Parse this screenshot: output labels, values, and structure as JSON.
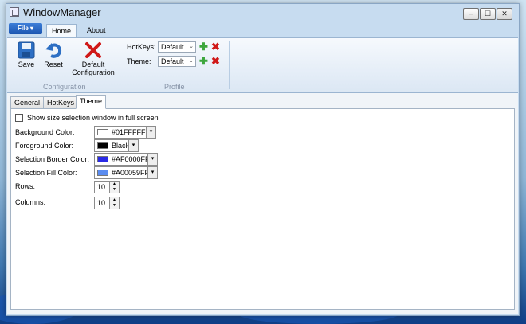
{
  "window": {
    "title": "WindowManager"
  },
  "window_controls": {
    "minimize": "–",
    "maximize": "☐",
    "close": "✕"
  },
  "ribbon_tabs": {
    "file": "File ▾",
    "home": "Home",
    "about": "About"
  },
  "ribbon": {
    "configuration": {
      "group_label": "Configuration",
      "save": "Save",
      "reset": "Reset",
      "default_line1": "Default",
      "default_line2": "Configuration"
    },
    "profile": {
      "group_label": "Profile",
      "hotkeys_label": "HotKeys:",
      "hotkeys_value": "Default",
      "theme_label": "Theme:",
      "theme_value": "Default"
    }
  },
  "content_tabs": {
    "general": "General",
    "hotkeys": "HotKeys",
    "theme": "Theme"
  },
  "theme": {
    "fullscreen_checkbox_label": "Show size selection window in full screen",
    "background_label": "Background Color:",
    "background_value": "#01FFFFFF",
    "background_swatch": "#FFFFFF",
    "foreground_label": "Foreground Color:",
    "foreground_value": "Black",
    "foreground_swatch": "#000000",
    "border_label": "Selection Border Color:",
    "border_value": "#AF0000FF",
    "border_swatch": "#2A2AE6",
    "fill_label": "Selection Fill Color:",
    "fill_value": "#A00059FF",
    "fill_swatch": "#5A8CF0",
    "rows_label": "Rows:",
    "rows_value": "10",
    "columns_label": "Columns:",
    "columns_value": "10"
  }
}
